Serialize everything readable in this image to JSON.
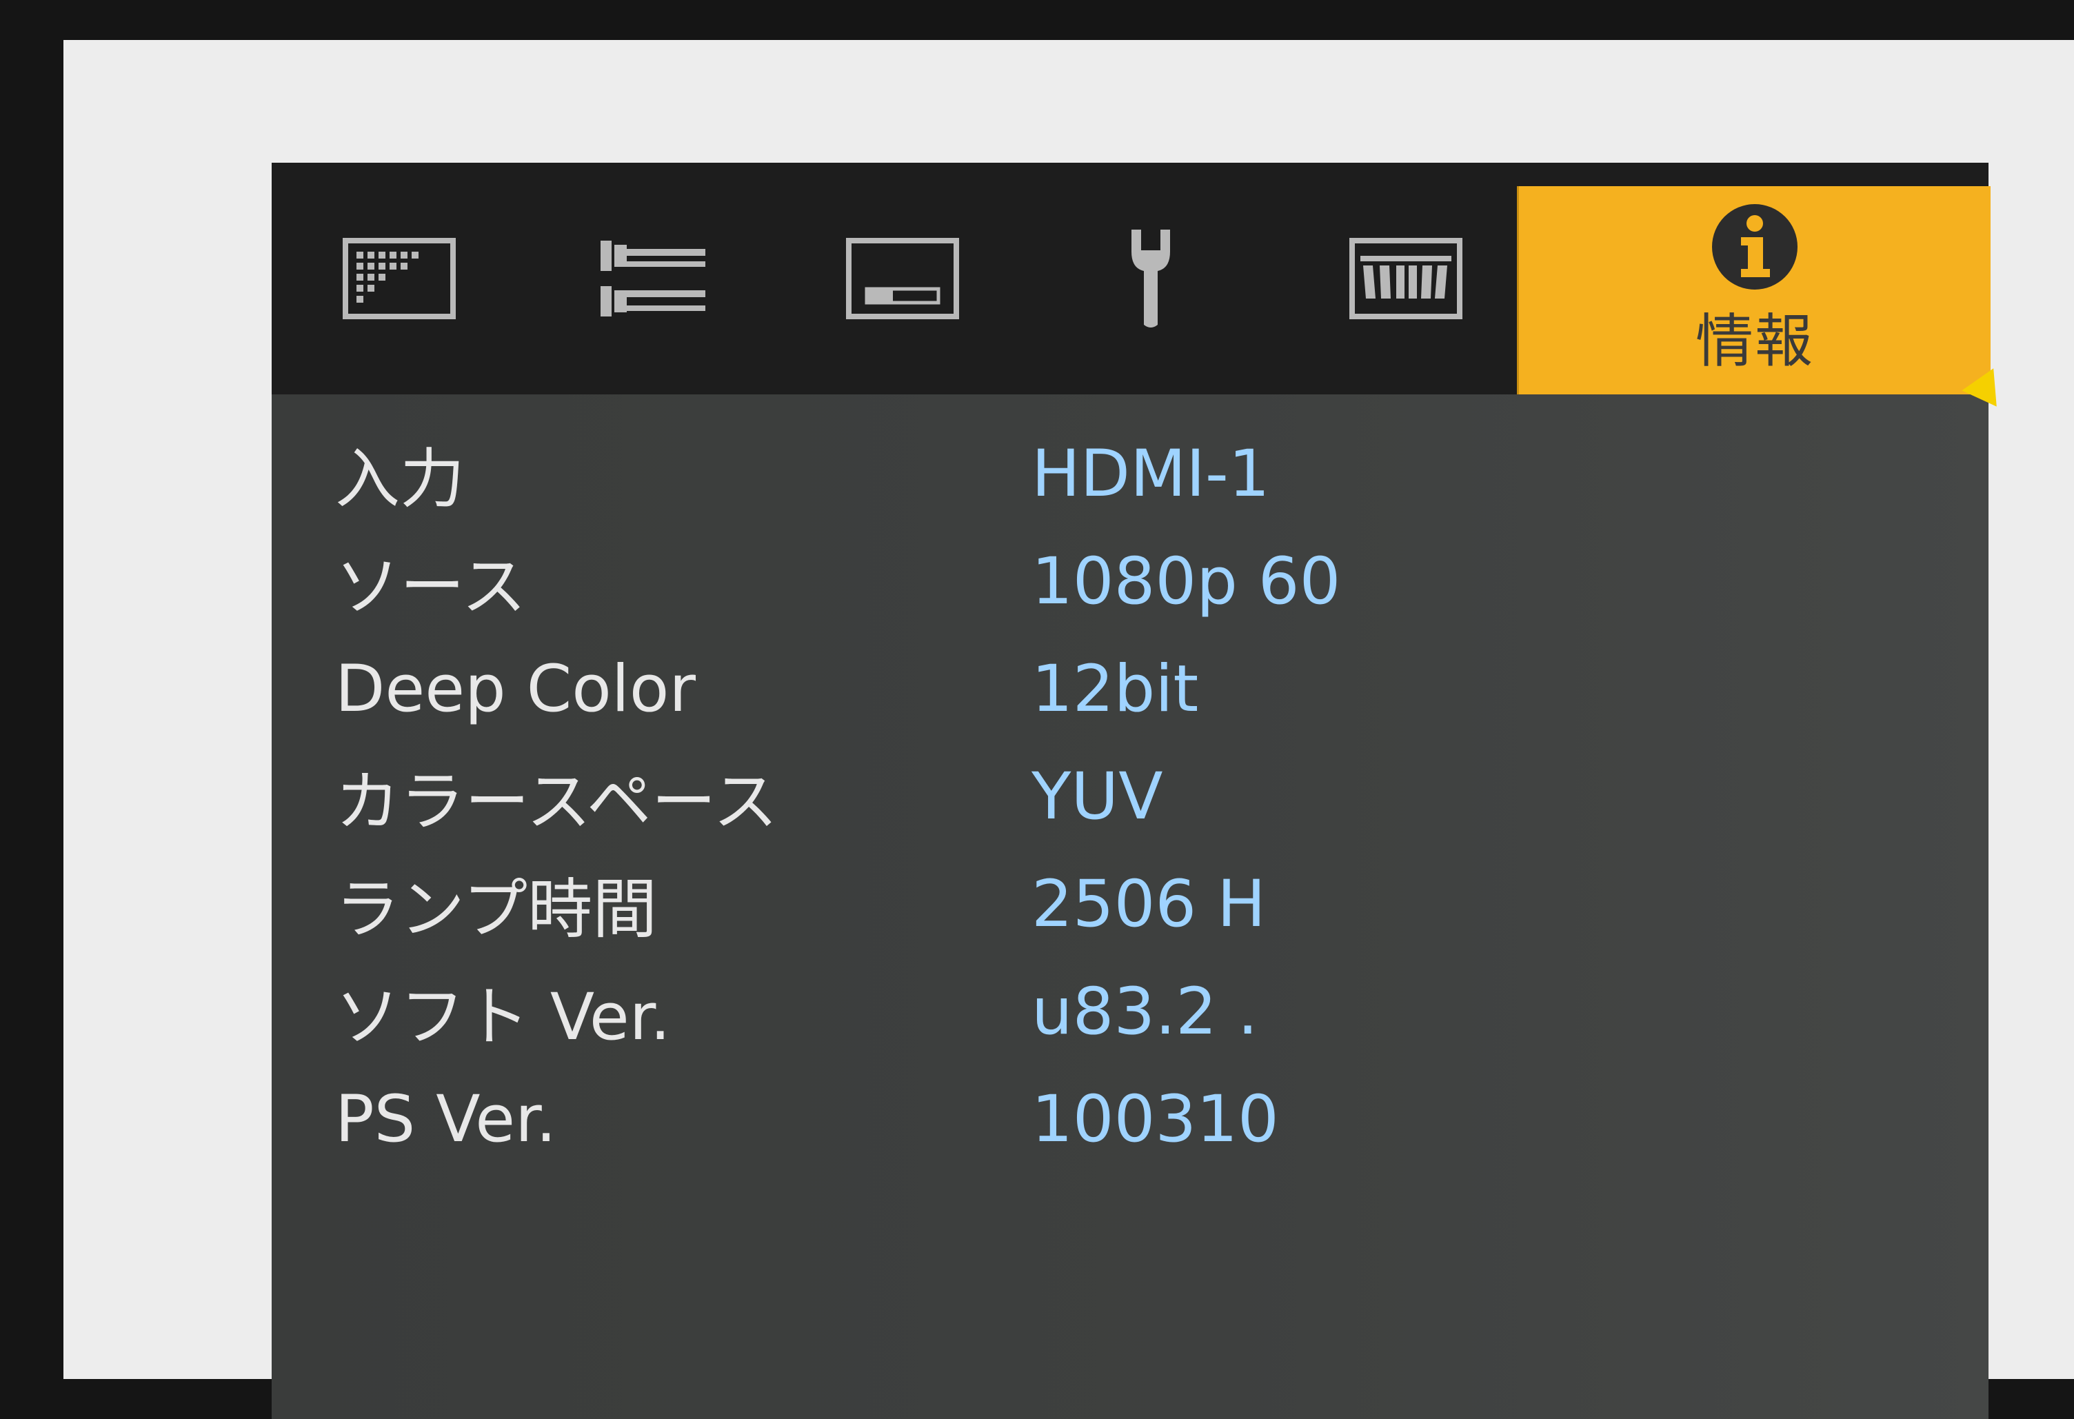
{
  "tabs": [
    {
      "icon": "picture-icon",
      "label": ""
    },
    {
      "icon": "input-icon",
      "label": ""
    },
    {
      "icon": "display-icon",
      "label": ""
    },
    {
      "icon": "wrench-icon",
      "label": ""
    },
    {
      "icon": "keystone-icon",
      "label": ""
    },
    {
      "icon": "info-icon",
      "label": "情報"
    }
  ],
  "active_tab_color": "#f5b11f",
  "info": {
    "rows": [
      {
        "label": "入力",
        "value": "HDMI-1"
      },
      {
        "label": "ソース",
        "value": "1080p 60"
      },
      {
        "label": "Deep Color",
        "value": "12bit"
      },
      {
        "label": "カラースペース",
        "value": "YUV"
      },
      {
        "label": "ランプ時間",
        "value": "2506 H"
      },
      {
        "label": "ソフト Ver.",
        "value": "u83.2 ."
      },
      {
        "label": "PS Ver.",
        "value": "100310"
      }
    ]
  }
}
